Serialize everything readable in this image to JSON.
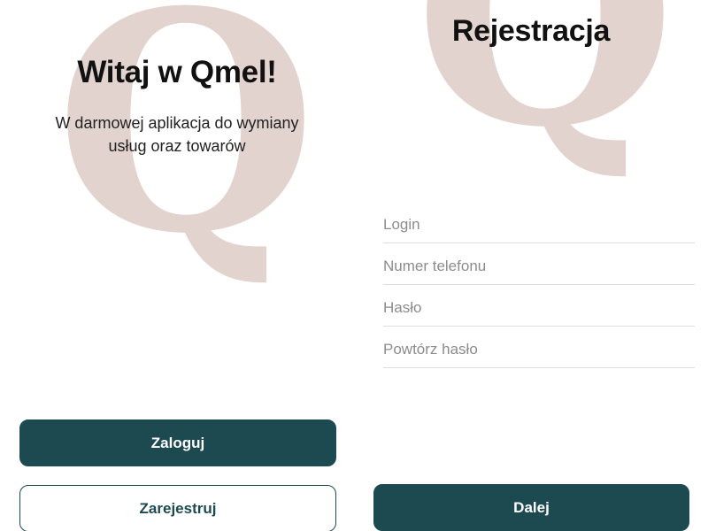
{
  "welcome_screen": {
    "logo_letter": "Q",
    "title": "Witaj w Qmel!",
    "subtitle": "W darmowej aplikacja do wymiany usług oraz towarów",
    "login_button": "Zaloguj",
    "register_button": "Zarejestruj"
  },
  "register_screen": {
    "logo_letter": "Q",
    "title": "Rejestracja",
    "fields": [
      {
        "placeholder": "Login",
        "value": ""
      },
      {
        "placeholder": "Numer telefonu",
        "value": ""
      },
      {
        "placeholder": "Hasło",
        "value": ""
      },
      {
        "placeholder": "Powtórz hasło",
        "value": ""
      }
    ],
    "next_button": "Dalej"
  },
  "colors": {
    "primary": "#1c4a50",
    "logo_watermark": "#e2d3ce",
    "divider": "#dedede",
    "placeholder": "#8c8c8c"
  }
}
